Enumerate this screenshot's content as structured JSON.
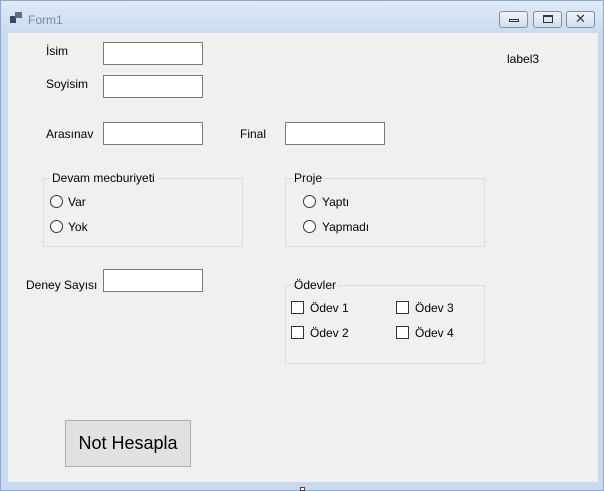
{
  "window": {
    "title": "Form1"
  },
  "form": {
    "isim_label": "İsim",
    "isim_value": "",
    "soyisim_label": "Soyisim",
    "soyisim_value": "",
    "arasinav_label": "Arasınav",
    "arasinav_value": "",
    "final_label": "Final",
    "final_value": "",
    "label3": "label3",
    "deney_label": "Deney Sayısı",
    "deney_value": ""
  },
  "devam": {
    "title": "Devam mecburiyeti",
    "options": [
      "Var",
      "Yok"
    ]
  },
  "proje": {
    "title": "Proje",
    "options": [
      "Yaptı",
      "Yapmadı"
    ]
  },
  "odevler": {
    "title": "Ödevler",
    "items": [
      "Ödev 1",
      "Ödev 2",
      "Ödev 3",
      "Ödev 4"
    ]
  },
  "buttons": {
    "calculate": "Not Hesapla"
  }
}
